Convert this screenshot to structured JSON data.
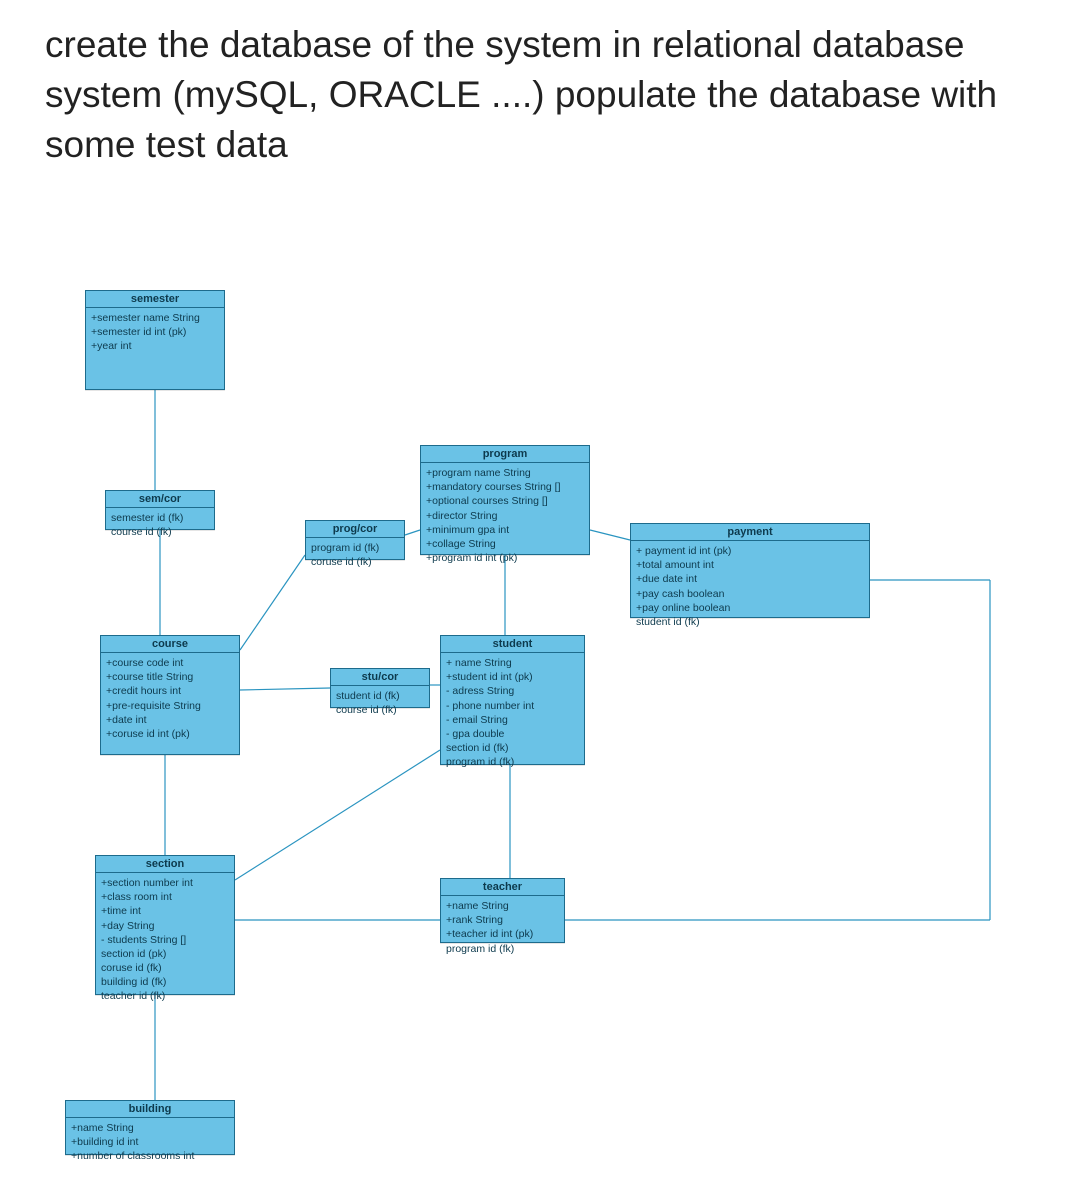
{
  "heading": "create the database of the system in relational database system (mySQL, ORACLE ....) populate the database with some test data",
  "entities": {
    "semester": {
      "title": "semester",
      "attrs": [
        "+semester name String",
        "+semester id int (pk)",
        "+year int"
      ]
    },
    "semcor": {
      "title": "sem/cor",
      "attrs": [
        "semester id (fk)",
        "course id (fk)"
      ]
    },
    "progcor": {
      "title": "prog/cor",
      "attrs": [
        "program id (fk)",
        "coruse id (fk)"
      ]
    },
    "program": {
      "title": "program",
      "attrs": [
        "+program name String",
        "+mandatory courses String []",
        "+optional courses String []",
        "+director String",
        "+minimum gpa int",
        "+collage String",
        "+program id int (pk)"
      ]
    },
    "payment": {
      "title": "payment",
      "attrs": [
        "+ payment id int (pk)",
        "+total amount int",
        "+due date int",
        "+pay cash boolean",
        "+pay online boolean",
        "student id (fk)"
      ]
    },
    "course": {
      "title": "course",
      "attrs": [
        "+course code int",
        "+course title String",
        "+credit hours int",
        "+pre-requisite String",
        "+date int",
        "+coruse id int (pk)"
      ]
    },
    "stucor": {
      "title": "stu/cor",
      "attrs": [
        "student id (fk)",
        "course id (fk)"
      ]
    },
    "student": {
      "title": "student",
      "attrs": [
        "+ name String",
        "+student id int (pk)",
        "- adress String",
        "- phone number int",
        "- email String",
        "- gpa double",
        "section id (fk)",
        "program id (fk)"
      ]
    },
    "section": {
      "title": "section",
      "attrs": [
        "+section number int",
        "+class room int",
        "+time int",
        "+day String",
        "- students String []",
        "section id (pk)",
        "coruse id (fk)",
        "building id (fk)",
        "teacher id (fk)"
      ]
    },
    "teacher": {
      "title": "teacher",
      "attrs": [
        "+name String",
        "+rank String",
        "+teacher id int (pk)",
        "program id (fk)"
      ]
    },
    "building": {
      "title": "building",
      "attrs": [
        "+name String",
        "+building id int",
        "+number of classrooms int"
      ]
    }
  }
}
